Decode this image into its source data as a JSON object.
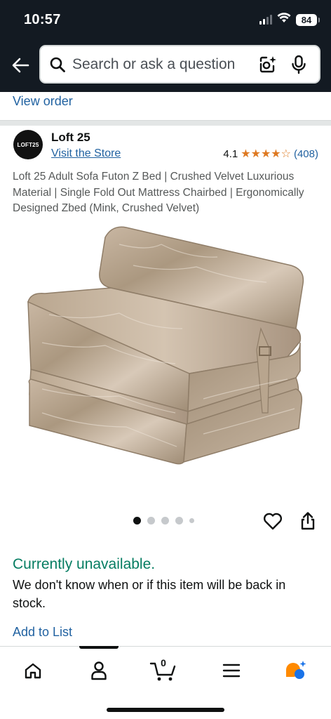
{
  "status_bar": {
    "time": "10:57",
    "battery": "84"
  },
  "header": {
    "search_placeholder": "Search or ask a question",
    "icons": [
      "back-arrow-icon",
      "search-icon",
      "camera-lens-icon",
      "microphone-icon"
    ]
  },
  "previous_section": {
    "view_order_label": "View order"
  },
  "brand": {
    "logo_text": "LOFT25",
    "name": "Loft 25",
    "visit_store_label": "Visit the Store"
  },
  "rating": {
    "value": "4.1",
    "stars": 4.1,
    "count": "(408)"
  },
  "product": {
    "title": "Loft 25 Adult Sofa Futon Z Bed | Crushed Velvet Luxurious Material | Single Fold Out Mattress Chairbed | Ergonomically Designed Zbed (Mink, Crushed Velvet)",
    "image_alt": "Crushed velvet mink folding chair bed",
    "image_count": 5,
    "active_image_index": 0
  },
  "availability": {
    "status": "Currently unavailable.",
    "note": "We don't know when or if this item will be back in stock."
  },
  "actions": {
    "add_to_list_label": "Add to List"
  },
  "bottom_nav": {
    "items": [
      {
        "name": "home",
        "icon": "home-icon"
      },
      {
        "name": "you",
        "icon": "person-icon"
      },
      {
        "name": "cart",
        "icon": "cart-icon",
        "count": "0"
      },
      {
        "name": "menu",
        "icon": "menu-icon"
      },
      {
        "name": "rufus",
        "icon": "rufus-chat-icon"
      }
    ],
    "active_index": 1
  },
  "colors": {
    "header_bg": "#131a22",
    "link": "#2162a1",
    "availability": "#067d62",
    "star": "#de7921",
    "rufus_orange": "#ff8a00",
    "rufus_blue": "#1a73e8"
  }
}
